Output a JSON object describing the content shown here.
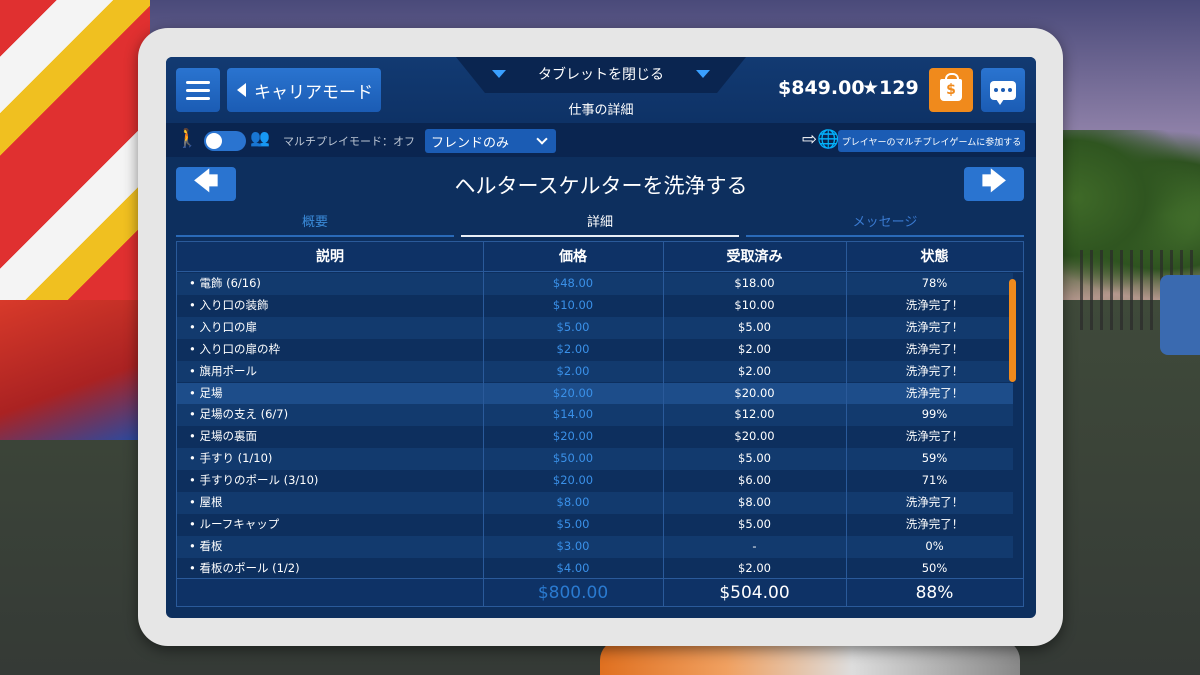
{
  "header": {
    "back_label": "キャリアモード",
    "close_tablet": "タブレットを閉じる",
    "subtitle": "仕事の詳細",
    "money": "$849.00",
    "stars": "★129",
    "shop_symbol": "$"
  },
  "multiplayer": {
    "mode_label": "マルチプレイモード：オフ",
    "friend_select": "フレンドのみ",
    "join_label": "プレイヤーのマルチプレイゲームに参加する"
  },
  "job": {
    "title": "ヘルタースケルターを洗浄する",
    "prev_symbol": "🡄",
    "next_symbol": "🡆"
  },
  "tabs": {
    "overview": "概要",
    "detail": "詳細",
    "messages": "メッセージ"
  },
  "table": {
    "headers": [
      "説明",
      "価格",
      "受取済み",
      "状態"
    ],
    "rows": [
      {
        "desc": "•  電飾 (6/16)",
        "price": "$48.00",
        "received": "$18.00",
        "status": "78%"
      },
      {
        "desc": "•  入り口の装飾",
        "price": "$10.00",
        "received": "$10.00",
        "status": "洗浄完了！"
      },
      {
        "desc": "•  入り口の扉",
        "price": "$5.00",
        "received": "$5.00",
        "status": "洗浄完了！"
      },
      {
        "desc": "•  入り口の扉の枠",
        "price": "$2.00",
        "received": "$2.00",
        "status": "洗浄完了！"
      },
      {
        "desc": "•  旗用ポール",
        "price": "$2.00",
        "received": "$2.00",
        "status": "洗浄完了！"
      },
      {
        "desc": "•  足場",
        "price": "$20.00",
        "received": "$20.00",
        "status": "洗浄完了！"
      },
      {
        "desc": "•  足場の支え (6/7)",
        "price": "$14.00",
        "received": "$12.00",
        "status": "99%"
      },
      {
        "desc": "•  足場の裏面",
        "price": "$20.00",
        "received": "$20.00",
        "status": "洗浄完了！"
      },
      {
        "desc": "•  手すり (1/10)",
        "price": "$50.00",
        "received": "$5.00",
        "status": "59%"
      },
      {
        "desc": "•  手すりのポール (3/10)",
        "price": "$20.00",
        "received": "$6.00",
        "status": "71%"
      },
      {
        "desc": "•  屋根",
        "price": "$8.00",
        "received": "$8.00",
        "status": "洗浄完了！"
      },
      {
        "desc": "•  ルーフキャップ",
        "price": "$5.00",
        "received": "$5.00",
        "status": "洗浄完了！"
      },
      {
        "desc": "•  看板",
        "price": "$3.00",
        "received": "-",
        "status": "0%"
      },
      {
        "desc": "•  看板のポール (1/2)",
        "price": "$4.00",
        "received": "$2.00",
        "status": "50%"
      }
    ],
    "totals": {
      "price": "$800.00",
      "received": "$504.00",
      "status": "88%"
    }
  },
  "icons": {
    "menu": "hamburger-icon",
    "back": "triangle-left-icon",
    "shop": "shopping-bag-icon",
    "chat": "chat-bubble-icon",
    "walker": "walking-person-icon",
    "group": "group-walking-icon",
    "join": "globe-join-icon"
  },
  "colors": {
    "accent": "#2a74d0",
    "shop": "#f08a1c",
    "price_text": "#3a90e8",
    "screen_bg": "#0d2f5e"
  }
}
